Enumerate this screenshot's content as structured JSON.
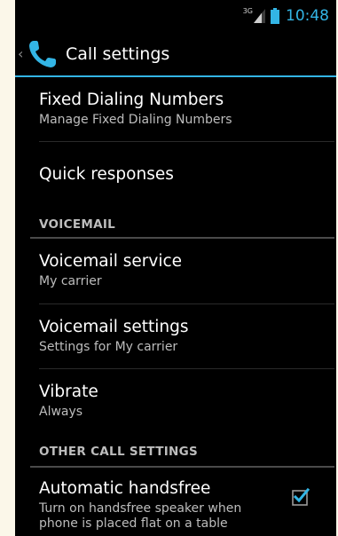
{
  "status_bar": {
    "network_type": "3G",
    "time": "10:48",
    "icons": [
      "signal-icon",
      "battery-icon"
    ]
  },
  "action_bar": {
    "title": "Call settings",
    "icons": [
      "up-caret-icon",
      "phone-icon"
    ]
  },
  "preferences": {
    "fdn": {
      "title": "Fixed Dialing Numbers",
      "summary": "Manage Fixed Dialing Numbers"
    },
    "quick_responses": {
      "title": "Quick responses"
    },
    "voicemail_category": "VOICEMAIL",
    "voicemail_service": {
      "title": "Voicemail service",
      "summary": "My carrier"
    },
    "voicemail_settings": {
      "title": "Voicemail settings",
      "summary": "Settings for My carrier"
    },
    "vibrate": {
      "title": "Vibrate",
      "summary": "Always"
    },
    "other_category": "OTHER CALL SETTINGS",
    "auto_handsfree": {
      "title": "Automatic handsfree",
      "summary": "Turn on handsfree speaker when phone is placed flat on a table",
      "checked": true
    }
  },
  "colors": {
    "accent": "#33b5e5",
    "background": "#000000",
    "outer_background": "#fbf7e9",
    "summary_text": "#bdbdbd"
  }
}
